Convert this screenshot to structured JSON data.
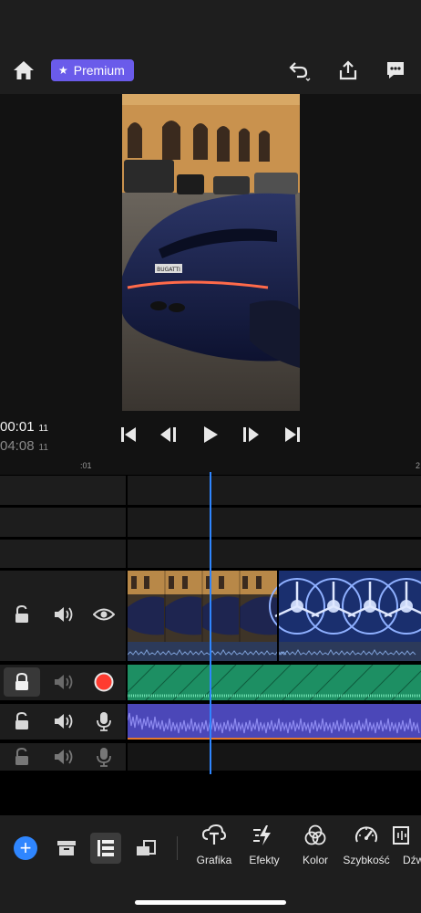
{
  "top_bar": {
    "premium_label": "Premium",
    "icons": [
      "home-icon",
      "undo-icon",
      "share-icon",
      "feedback-icon"
    ]
  },
  "preview": {
    "current_time": "00:01",
    "current_frame": "11",
    "total_time": "04:08",
    "total_frame": "11",
    "license_plate": "BUGATTI"
  },
  "timeline": {
    "ruler_label": ":01",
    "ruler_label_right": "2"
  },
  "tools": [
    {
      "label": "Grafika",
      "icon": "graphics-icon"
    },
    {
      "label": "Efekty",
      "icon": "effects-icon"
    },
    {
      "label": "Kolor",
      "icon": "color-icon"
    },
    {
      "label": "Szybkość",
      "icon": "speed-icon"
    },
    {
      "label": "Dźw",
      "icon": "audio-icon"
    }
  ],
  "colors": {
    "accent": "#2f86ff",
    "premium": "#6a5bea",
    "record": "#ff3b30",
    "audio_green": "#1d8f63",
    "audio_purple": "#4b47b8",
    "audio_outline": "#e6792e"
  }
}
